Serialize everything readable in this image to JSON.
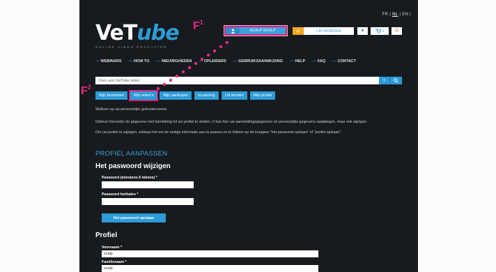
{
  "languages": [
    "FR",
    "NL",
    "EN"
  ],
  "language_active": "NL",
  "logo": {
    "main_1": "VeT",
    "main_2": "ube",
    "sub": "ONLINE VIDEO EDUCATION"
  },
  "header": {
    "user_label": "SCALP SCALP",
    "lid_worden_label": "LID WORDEN",
    "cart_count": "1"
  },
  "annotations": {
    "f1": "F",
    "f1_sup": "1",
    "f2": "F",
    "f2_sup": "2"
  },
  "nav": {
    "items": [
      "WEBINARS",
      "HOW TO",
      "NIEUWIGHEDEN",
      "OPLEIDERS",
      "GEBRUIKSAANWIJZING",
      "HELP",
      "FAQ",
      "CONTACT"
    ]
  },
  "search": {
    "placeholder": "Zoek een VetTube video"
  },
  "tabs": [
    "Mijn favorieten",
    "Mijn video's",
    "Mijn aankopen",
    "eLearning",
    "Lid worden",
    "Mijn profiel"
  ],
  "intro": {
    "welcome": "Welkom op uw persoonlijke gebruikerszone.",
    "line2": "Gelieve hieronder de gegevens met betrekking tot uw profiel te vinden. U kan hier uw aanmeldingsgegevens en persoonlijke gegevens raadplegen, maar ook wijzigen.",
    "line3": "Om uw profiel te wijzigen, volstaat het om de nodige informatie aan te passen en te klikken op de knoppen \"het paswoord opslaan\" of \"profiel opslaan\"."
  },
  "profile_edit": {
    "title": "PROFIEL AANPASSEN",
    "password_heading": "Het paswoord wijzigen",
    "password_label": "Paswoord (minstens 6 tekens) *",
    "password_value": "",
    "password_repeat_label": "Paswoord herhalen *",
    "password_repeat_value": "",
    "save_password_label": "Het paswoord opslaan",
    "profile_heading": "Profiel",
    "first_name_label": "Voornaam *",
    "first_name_value": "scalp",
    "last_name_label": "Familienaam *",
    "last_name_value": "scalp"
  },
  "colors": {
    "accent": "#2d9bd7",
    "annotation": "#e6297f",
    "background": "#171a1e"
  }
}
